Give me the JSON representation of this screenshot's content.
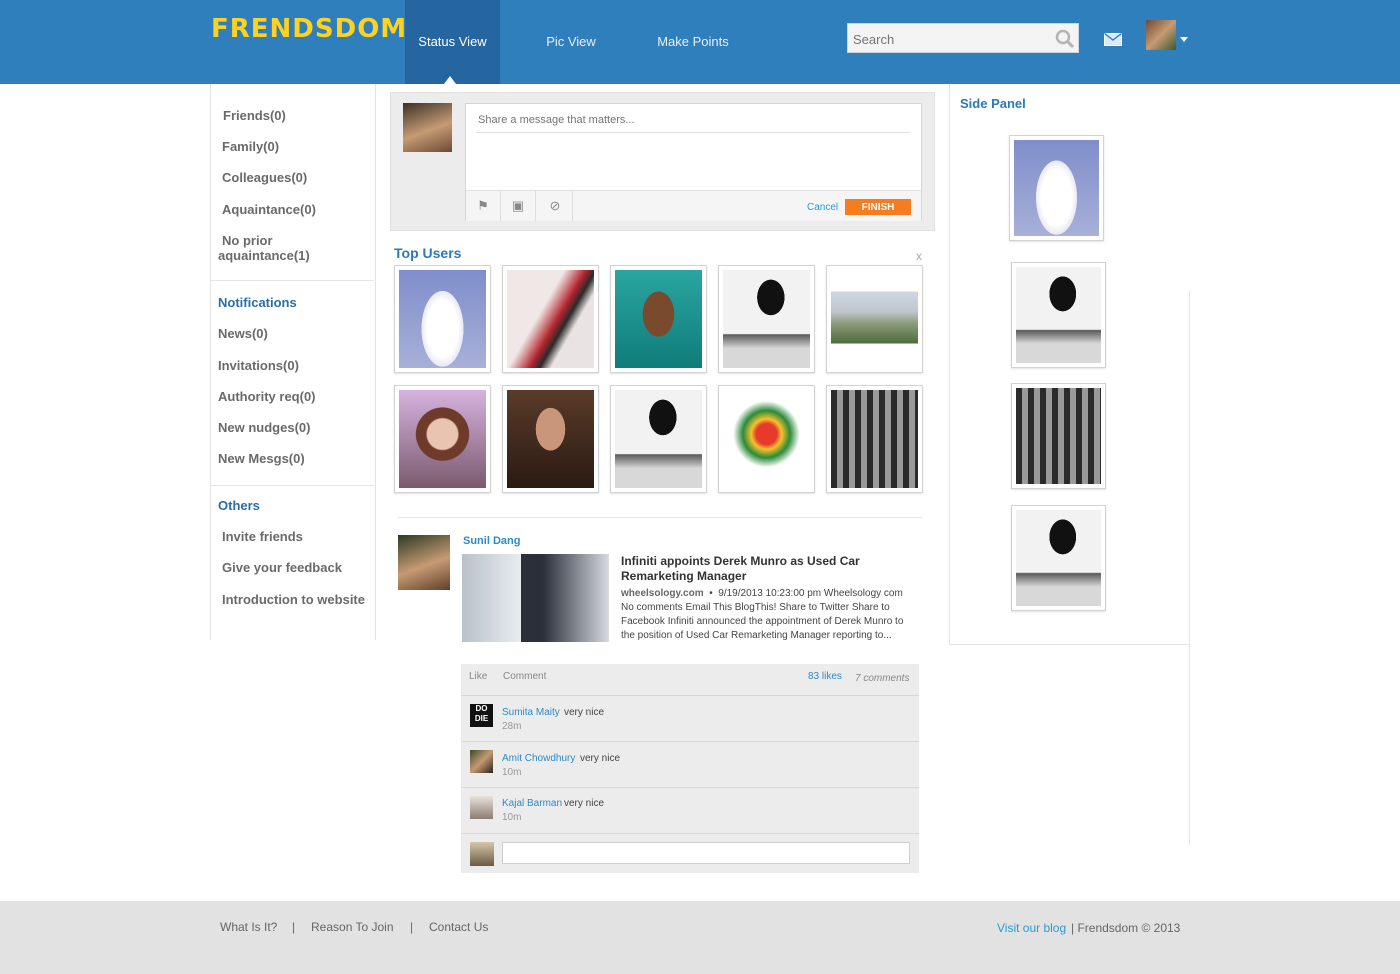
{
  "app": {
    "logo": "FRENDSDOM"
  },
  "nav": {
    "status_view": "Status View",
    "pic_view": "Pic View",
    "make_points": "Make Points"
  },
  "search": {
    "placeholder": "Search"
  },
  "left_sidebar": {
    "groups": [
      "Friends(0)",
      "Family(0)",
      "Colleagues(0)",
      "Aquaintance(0)",
      "No prior",
      "aquaintance(1)"
    ],
    "notifications_title": "Notifications",
    "notifications": [
      "News(0)",
      "Invitations(0)",
      "Authority req(0)",
      "New nudges(0)",
      "New Mesgs(0)"
    ],
    "others_title": "Others",
    "others": [
      "Invite friends",
      "Give your feedback",
      "Introduction to website"
    ]
  },
  "composer": {
    "placeholder": "Share a message that matters...",
    "cancel_label": "Cancel",
    "finish_label": "FINISH"
  },
  "top_users": {
    "title": "Top Users",
    "close_label": "x"
  },
  "post": {
    "author": "Sunil Dang",
    "title": "Infiniti appoints Derek Munro as Used Car Remarketing Manager",
    "source": "wheelsology.com",
    "bullet": "•",
    "meta": "9/19/2013 10:23:00 pm Wheelsology com No comments Email This BlogThis! Share to Twitter Share to Facebook Infiniti announced the appointment of Derek Munro to the position of Used Car Remarketing Manager reporting to...",
    "like_label": "Like",
    "comment_label": "Comment",
    "likes": "83 likes",
    "comments_count": "7 comments",
    "comments": [
      {
        "name": "Sumita Maity",
        "text": "very nice",
        "time": "28m"
      },
      {
        "name": "Amit Chowdhury",
        "text": "very nice",
        "time": "10m"
      },
      {
        "name": "Kajal Barman",
        "text": "very nice",
        "time": "10m"
      }
    ]
  },
  "side_panel": {
    "title": "Side Panel"
  },
  "footer": {
    "links": [
      "What Is It?",
      "Reason To Join",
      "Contact Us"
    ],
    "separator": "|",
    "visit_blog": "Visit our blog",
    "copyright": "| Frendsdom © 2013"
  },
  "colors": {
    "header": "#2f7fbc",
    "active_tab": "#2566a0",
    "logo": "#ffd21f",
    "accent_link": "#2a8bc9",
    "finish_button": "#f57c1f",
    "footer": "#e2e2e2"
  }
}
